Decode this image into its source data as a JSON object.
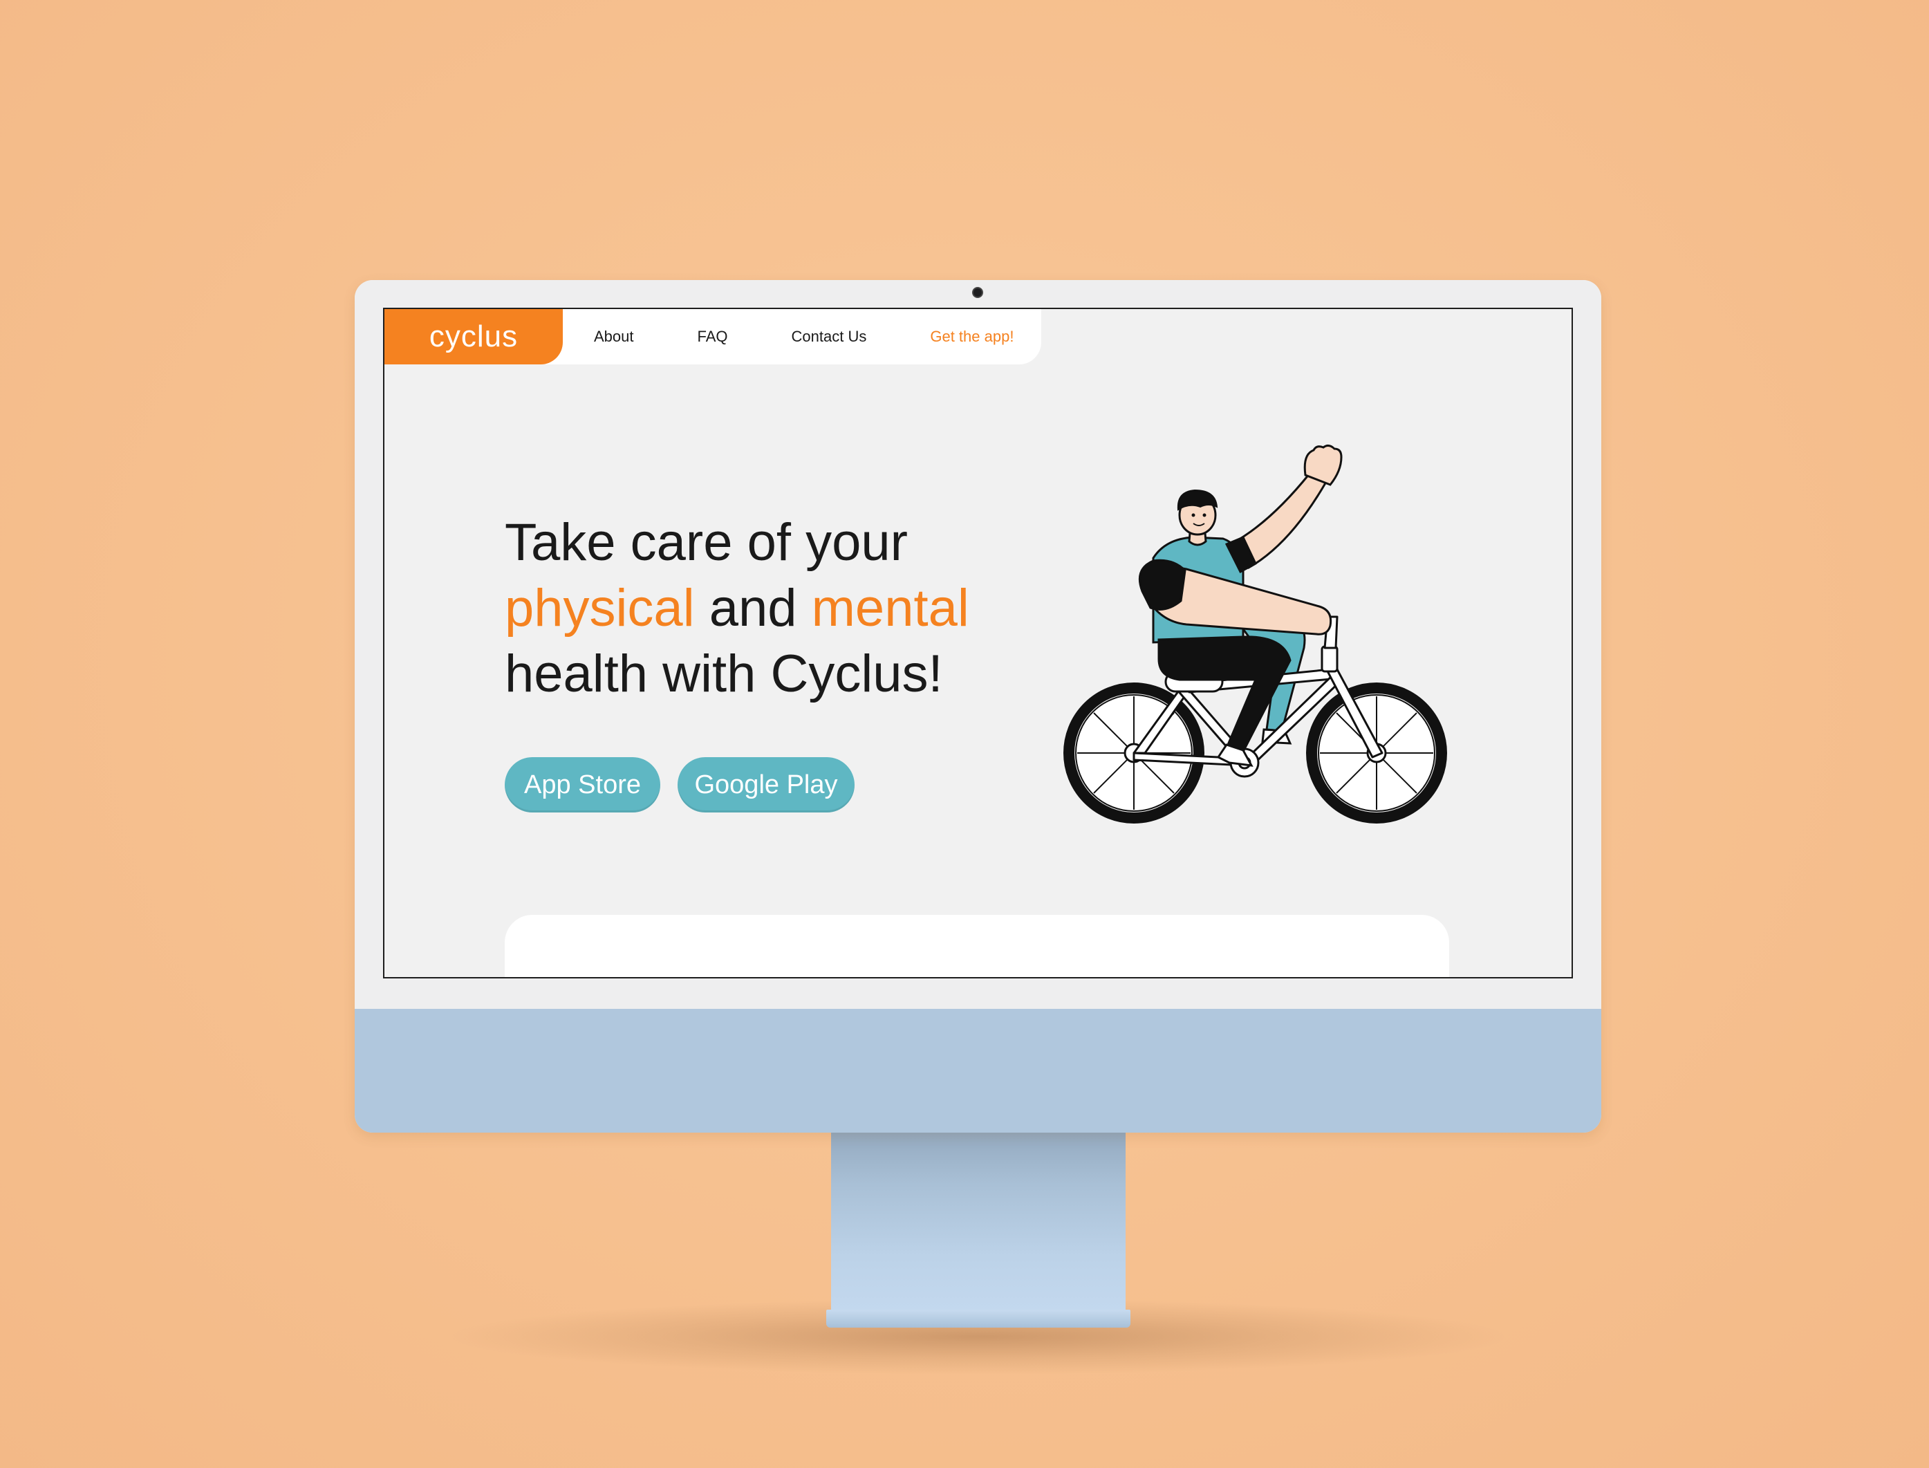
{
  "brand": {
    "logo_text": "cyclus",
    "accent_color": "#f58220",
    "button_color": "#5fb7c3"
  },
  "nav": {
    "about": "About",
    "faq": "FAQ",
    "contact": "Contact Us",
    "get_app": "Get the app!"
  },
  "hero": {
    "line1": "Take care of your",
    "line2_accent1": "physical",
    "line2_mid": " and ",
    "line2_accent2": "mental",
    "line3": "health with Cyclus!",
    "illustration": "person-waving-on-bicycle"
  },
  "buttons": {
    "app_store": "App Store",
    "google_play": "Google Play"
  },
  "device": {
    "type": "desktop-monitor-mockup",
    "color": "#b0c7dd"
  }
}
